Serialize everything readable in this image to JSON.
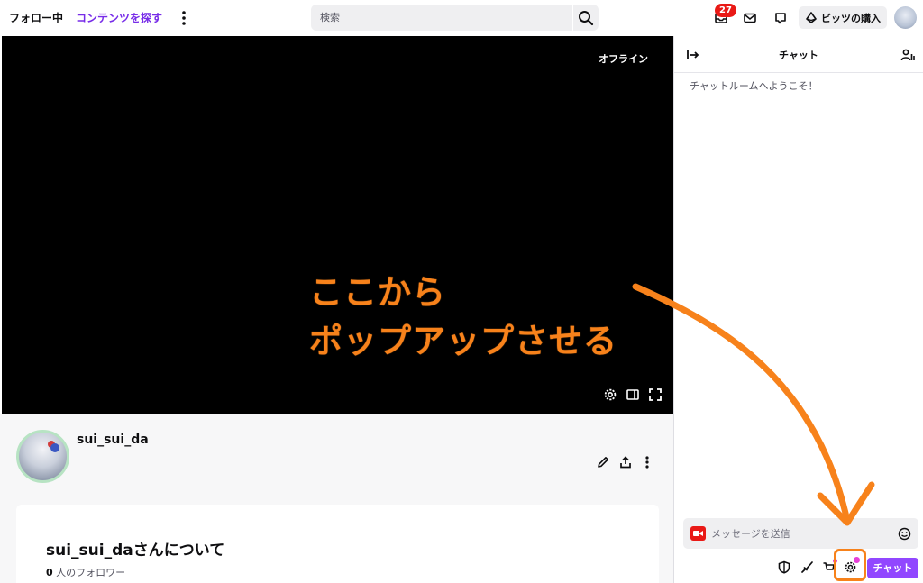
{
  "nav": {
    "following": "フォロー中",
    "browse": "コンテンツを探す",
    "search_placeholder": "検索",
    "notification_count": "27",
    "bits_label": "ビッツの購入"
  },
  "video": {
    "offline_label": "オフライン"
  },
  "channel": {
    "name": "sui_sui_da",
    "about_title": "sui_sui_daさんについて",
    "follower_count": "0",
    "follower_suffix": "人のフォロワー"
  },
  "chat": {
    "title": "チャット",
    "welcome": "チャットルームへようこそ！",
    "input_placeholder": "メッセージを送信",
    "send_label": "チャット"
  },
  "annotation": {
    "line1": "ここから",
    "line2": "ポップアップさせる",
    "color": "#f7821b"
  },
  "colors": {
    "accent": "#9147ff",
    "link": "#772ce8",
    "badge": "#e91916"
  }
}
